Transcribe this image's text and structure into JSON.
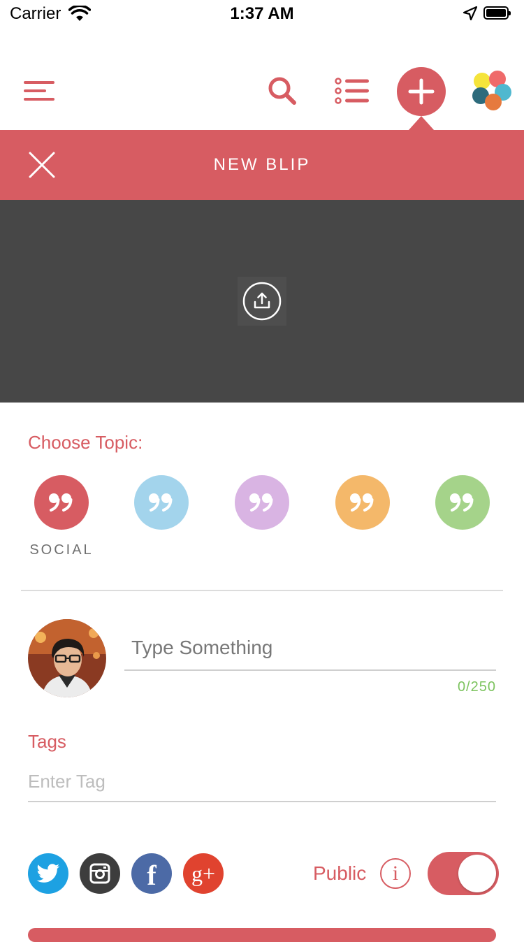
{
  "status_bar": {
    "carrier": "Carrier",
    "time": "1:37 AM"
  },
  "header": {
    "title": "NEW BLIP"
  },
  "topics": {
    "label": "Choose Topic:",
    "items": [
      {
        "name": "SOCIAL",
        "color": "#d75c62"
      },
      {
        "name": "",
        "color": "#a3d4ec"
      },
      {
        "name": "",
        "color": "#d9b4e3"
      },
      {
        "name": "",
        "color": "#f4b86a"
      },
      {
        "name": "",
        "color": "#a5d38a"
      }
    ],
    "selected_caption": "SOCIAL",
    "quote_glyph": "”"
  },
  "composer": {
    "placeholder": "Type Something",
    "counter": "0/250"
  },
  "tags": {
    "label": "Tags",
    "placeholder": "Enter Tag"
  },
  "social": {
    "twitter_color": "#1da1e2",
    "instagram_color": "#3d3d3d",
    "facebook_color": "#4c6aa6",
    "googleplus_color": "#e0432f",
    "facebook_glyph": "f",
    "googleplus_glyph": "g+"
  },
  "visibility": {
    "label": "Public",
    "info_glyph": "i",
    "enabled": true
  },
  "theme": {
    "accent": "#d75c62",
    "media_bg": "#474747",
    "counter_color": "#7cc35e"
  }
}
